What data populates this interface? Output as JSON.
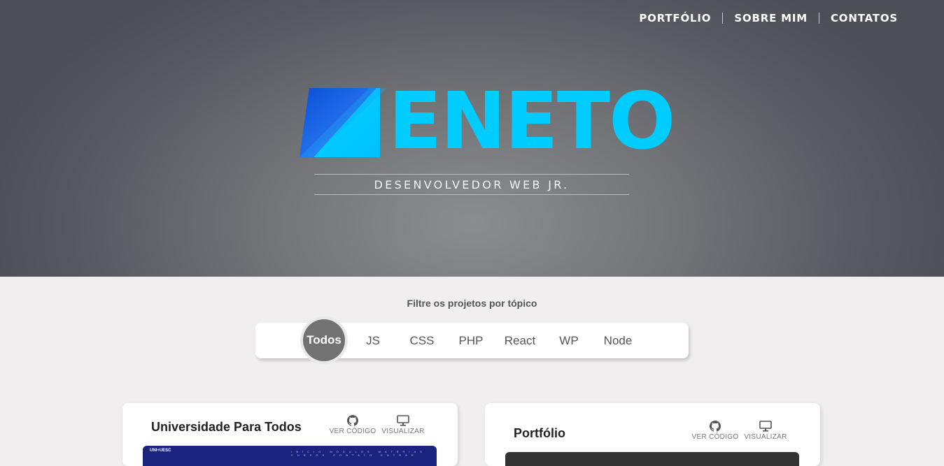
{
  "nav": {
    "items": [
      "PORTFÓLIO",
      "SOBRE MIM",
      "CONTATOS"
    ]
  },
  "hero": {
    "logo_text": "ENETO",
    "tagline": "DESENVOLVEDOR WEB JR.",
    "logo_color": "#00ccff"
  },
  "filter": {
    "label": "Filtre os projetos por tópico",
    "items": [
      "Todos",
      "JS",
      "CSS",
      "PHP",
      "React",
      "WP",
      "Node"
    ],
    "active": "Todos"
  },
  "projects": [
    {
      "title": "Universidade Para Todos",
      "code_label": "VER CÓDIGO",
      "view_label": "VISUALIZAR",
      "code_icon": "github-icon",
      "view_icon": "monitor-icon",
      "thumbnail_logo": "UNI+UESC",
      "thumbnail_menu": "INÍCIO MÓDULOS MATÉRIAS CURSOS CONTATO ENTRAR"
    },
    {
      "title": "Portfólio",
      "code_label": "VER CÓDIGO",
      "view_label": "VISUALIZAR",
      "code_icon": "github-icon",
      "view_icon": "monitor-icon"
    }
  ]
}
